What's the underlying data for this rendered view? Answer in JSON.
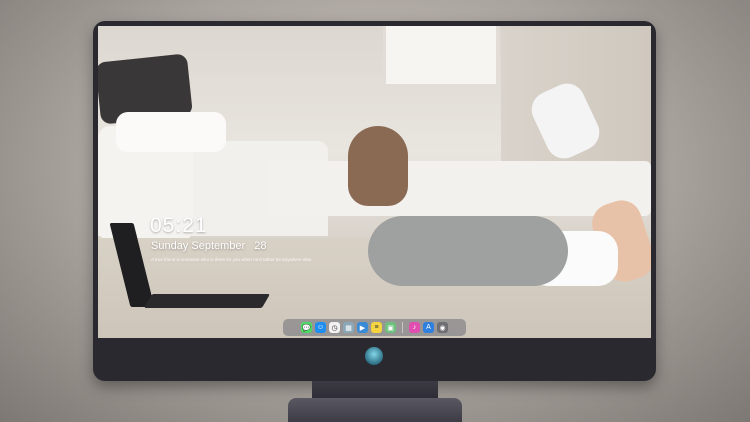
{
  "lockscreen": {
    "time": "05:21",
    "weekday": "Sunday",
    "month": "September",
    "day": "28",
    "quote": "A true friend is someone who is there for you when he'd rather be anywhere else."
  },
  "dock": {
    "apps": [
      {
        "name": "messages-icon",
        "color": "#4cd964",
        "glyph": "💬"
      },
      {
        "name": "finder-icon",
        "color": "#1f8ef1",
        "glyph": "☺"
      },
      {
        "name": "clock-icon",
        "color": "#f2f2f2",
        "glyph": "◷"
      },
      {
        "name": "preview-icon",
        "color": "#8aa8b8",
        "glyph": "▦"
      },
      {
        "name": "video-icon",
        "color": "#3a8bd6",
        "glyph": "▶"
      },
      {
        "name": "notes-icon",
        "color": "#f5d442",
        "glyph": "≡"
      },
      {
        "name": "photos-icon",
        "color": "#6fbf7f",
        "glyph": "▣"
      },
      {
        "name": "music-icon",
        "color": "#e04fb0",
        "glyph": "♪"
      },
      {
        "name": "appstore-icon",
        "color": "#2d7fe0",
        "glyph": "A"
      },
      {
        "name": "camera-icon",
        "color": "#6e6e73",
        "glyph": "◉"
      }
    ]
  },
  "colors": {
    "monitor": "#2a2930",
    "dock": "rgba(110,110,120,0.55)"
  }
}
